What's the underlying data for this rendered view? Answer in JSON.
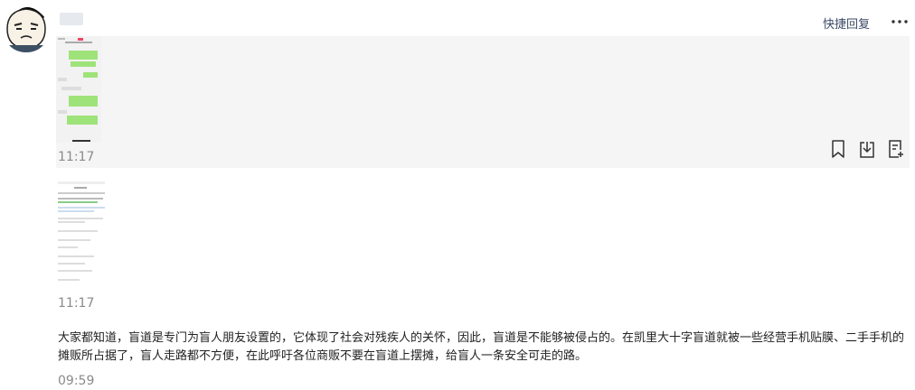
{
  "header": {
    "quick_reply_label": "快捷回复",
    "more_icon": "more-horizontal-icon"
  },
  "messages": [
    {
      "type": "image",
      "time": "11:17"
    },
    {
      "type": "image",
      "time": "11:17"
    },
    {
      "type": "text",
      "text": "大家都知道，盲道是专门为盲人朋友设置的，它体现了社会对残疾人的关怀，因此，盲道是不能够被侵占的。在凯里大十字盲道就被一些经营手机贴膜、二手手机的摊贩所占据了，盲人走路都不方便，在此呼吁各位商贩不要在盲道上摆摊，给盲人一条安全可走的路。",
      "time": "09:59"
    }
  ],
  "actions": {
    "bookmark_icon": "bookmark-icon",
    "download_icon": "download-icon",
    "note_icon": "add-note-icon"
  },
  "colors": {
    "message_bg": "#f5f5f5",
    "chat_green": "#9ee37a",
    "link_color": "#3b4a66"
  }
}
